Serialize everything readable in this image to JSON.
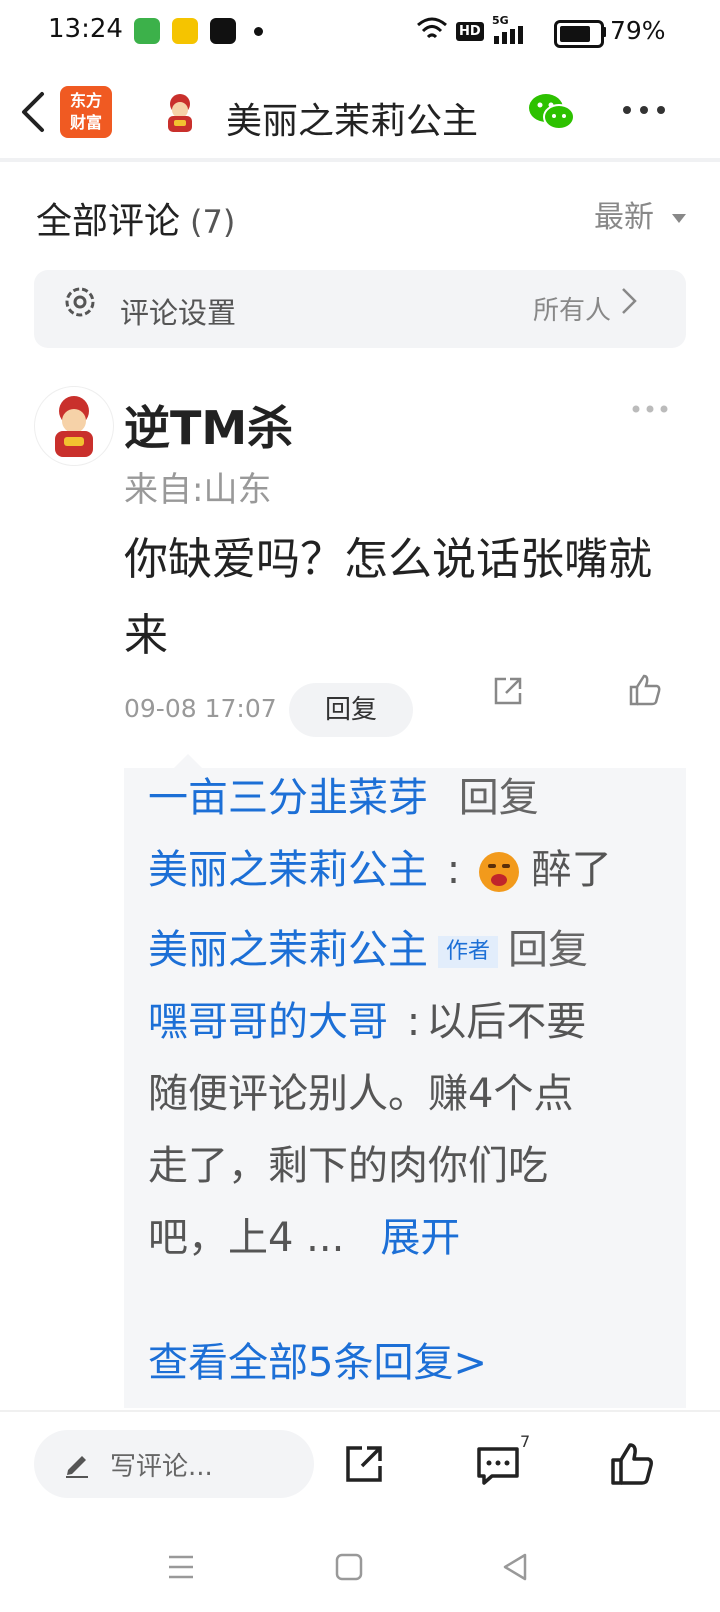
{
  "status_bar": {
    "time": "13:24",
    "network": "5G",
    "hd": "HD",
    "battery": "79%",
    "battery_level": 0.79
  },
  "header": {
    "back_icon": "chevron-left-icon",
    "app_logo_line1": "东方",
    "app_logo_line2": "财富",
    "title": "美丽之茉莉公主",
    "wechat_icon": "wechat-icon",
    "more_icon": "more-dots-icon"
  },
  "comments_header": {
    "title": "全部评论",
    "count": "(7)",
    "sort_label": "最新"
  },
  "settings": {
    "label": "评论设置",
    "value": "所有人"
  },
  "comment": {
    "username": "逆TM杀",
    "location": "来自:山东",
    "text": "你缺爱吗？怎么说话张嘴就来",
    "timestamp": "09-08 17:07",
    "reply_label": "回复",
    "replies": {
      "r1_user": "一亩三分韭菜芽",
      "r1_action": "回复",
      "r1_target": "美丽之茉莉公主",
      "r1_text": "醉了",
      "r2_user": "美丽之茉莉公主",
      "r2_tag": "作者",
      "r2_action": "回复",
      "r2_target": "嘿哥哥的大哥",
      "r2_text_1": "以后不要",
      "r2_text_2": "随便评论别人。赚4个点",
      "r2_text_3": "走了，剩下的肉你们吃",
      "r2_text_4": "吧，上4 ...",
      "expand": "展开",
      "view_all": "查看全部5条回复>"
    }
  },
  "bottom_bar": {
    "write_placeholder": "写评论...",
    "comment_count": "7"
  }
}
